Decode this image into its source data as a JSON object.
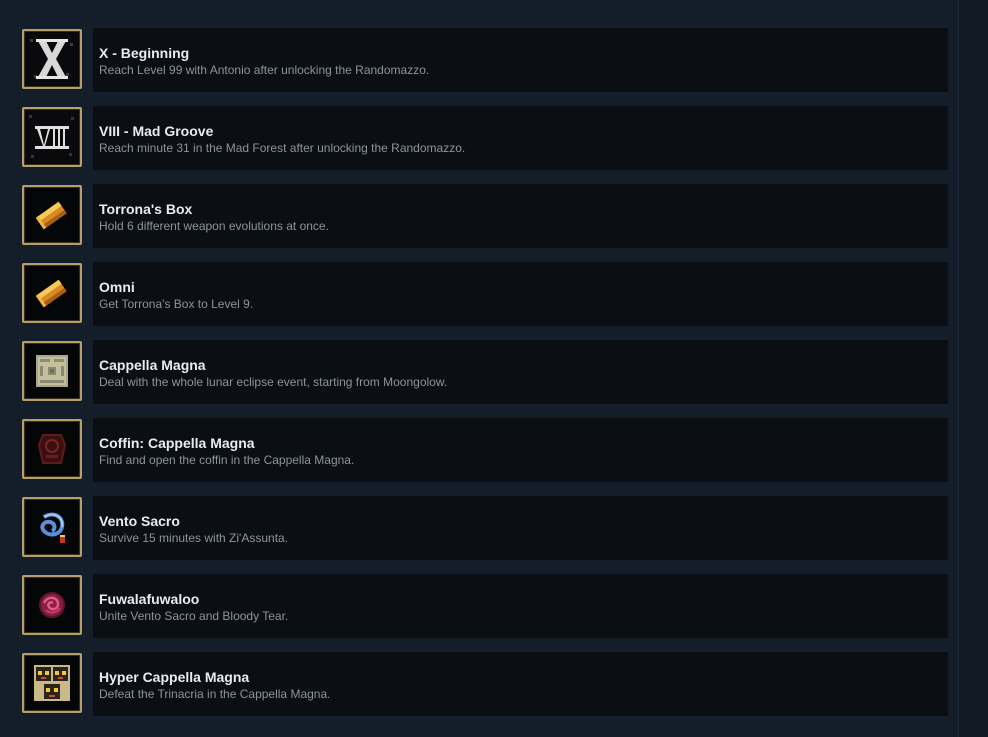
{
  "achievements": [
    {
      "title": "X - Beginning",
      "description": "Reach Level 99 with Antonio after unlocking the Randomazzo.",
      "icon": "roman-ten-icon"
    },
    {
      "title": "VIII - Mad Groove",
      "description": "Reach minute 31 in the Mad Forest after unlocking the Randomazzo.",
      "icon": "roman-eight-icon"
    },
    {
      "title": "Torrona's Box",
      "description": "Hold 6 different weapon evolutions at once.",
      "icon": "golden-box-icon"
    },
    {
      "title": "Omni",
      "description": "Get Torrona's Box to Level 9.",
      "icon": "golden-box-icon"
    },
    {
      "title": "Cappella Magna",
      "description": "Deal with the whole lunar eclipse event, starting from Moongolow.",
      "icon": "map-icon"
    },
    {
      "title": "Coffin: Cappella Magna",
      "description": "Find and open the coffin in the Cappella Magna.",
      "icon": "coffin-icon"
    },
    {
      "title": "Vento Sacro",
      "description": "Survive 15 minutes with Zi'Assunta.",
      "icon": "whip-icon"
    },
    {
      "title": "Fuwalafuwaloo",
      "description": "Unite Vento Sacro and Bloody Tear.",
      "icon": "rose-whirl-icon"
    },
    {
      "title": "Hyper Cappella Magna",
      "description": "Defeat the Trinacria in the Cappella Magna.",
      "icon": "trinacria-faces-icon"
    }
  ],
  "colors": {
    "frame": "#b5a06a",
    "card": "#0b0e13",
    "title": "#e9ecef",
    "description": "#8c949e"
  }
}
